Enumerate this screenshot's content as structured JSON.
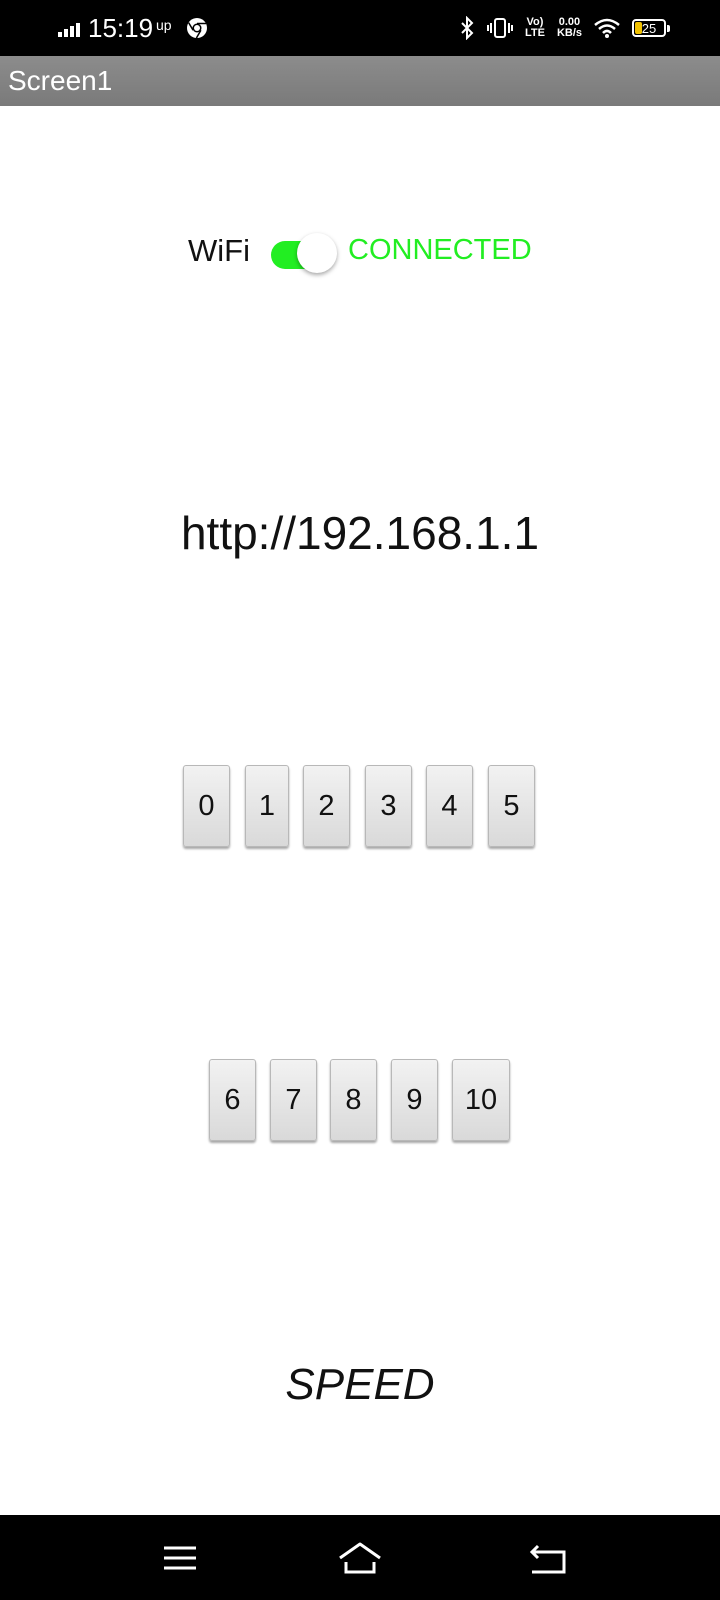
{
  "status_bar": {
    "time": "15:19",
    "network_tag": "up",
    "volte_line1": "Vo)",
    "volte_line2": "LTE",
    "speed_line1": "0.00",
    "speed_line2": "KB/s",
    "battery": "25"
  },
  "title_bar": {
    "title": "Screen1"
  },
  "wifi": {
    "label": "WiFi",
    "toggle_on": true,
    "status": "CONNECTED",
    "status_color": "#22ee22"
  },
  "url": "http://192.168.1.1",
  "buttons": {
    "row1": [
      "0",
      "1",
      "2",
      "3",
      "4",
      "5"
    ],
    "row2": [
      "6",
      "7",
      "8",
      "9",
      "10"
    ]
  },
  "speed_label": "SPEED",
  "nav_bar": {
    "icons": [
      "menu-icon",
      "home-icon",
      "back-icon"
    ]
  }
}
